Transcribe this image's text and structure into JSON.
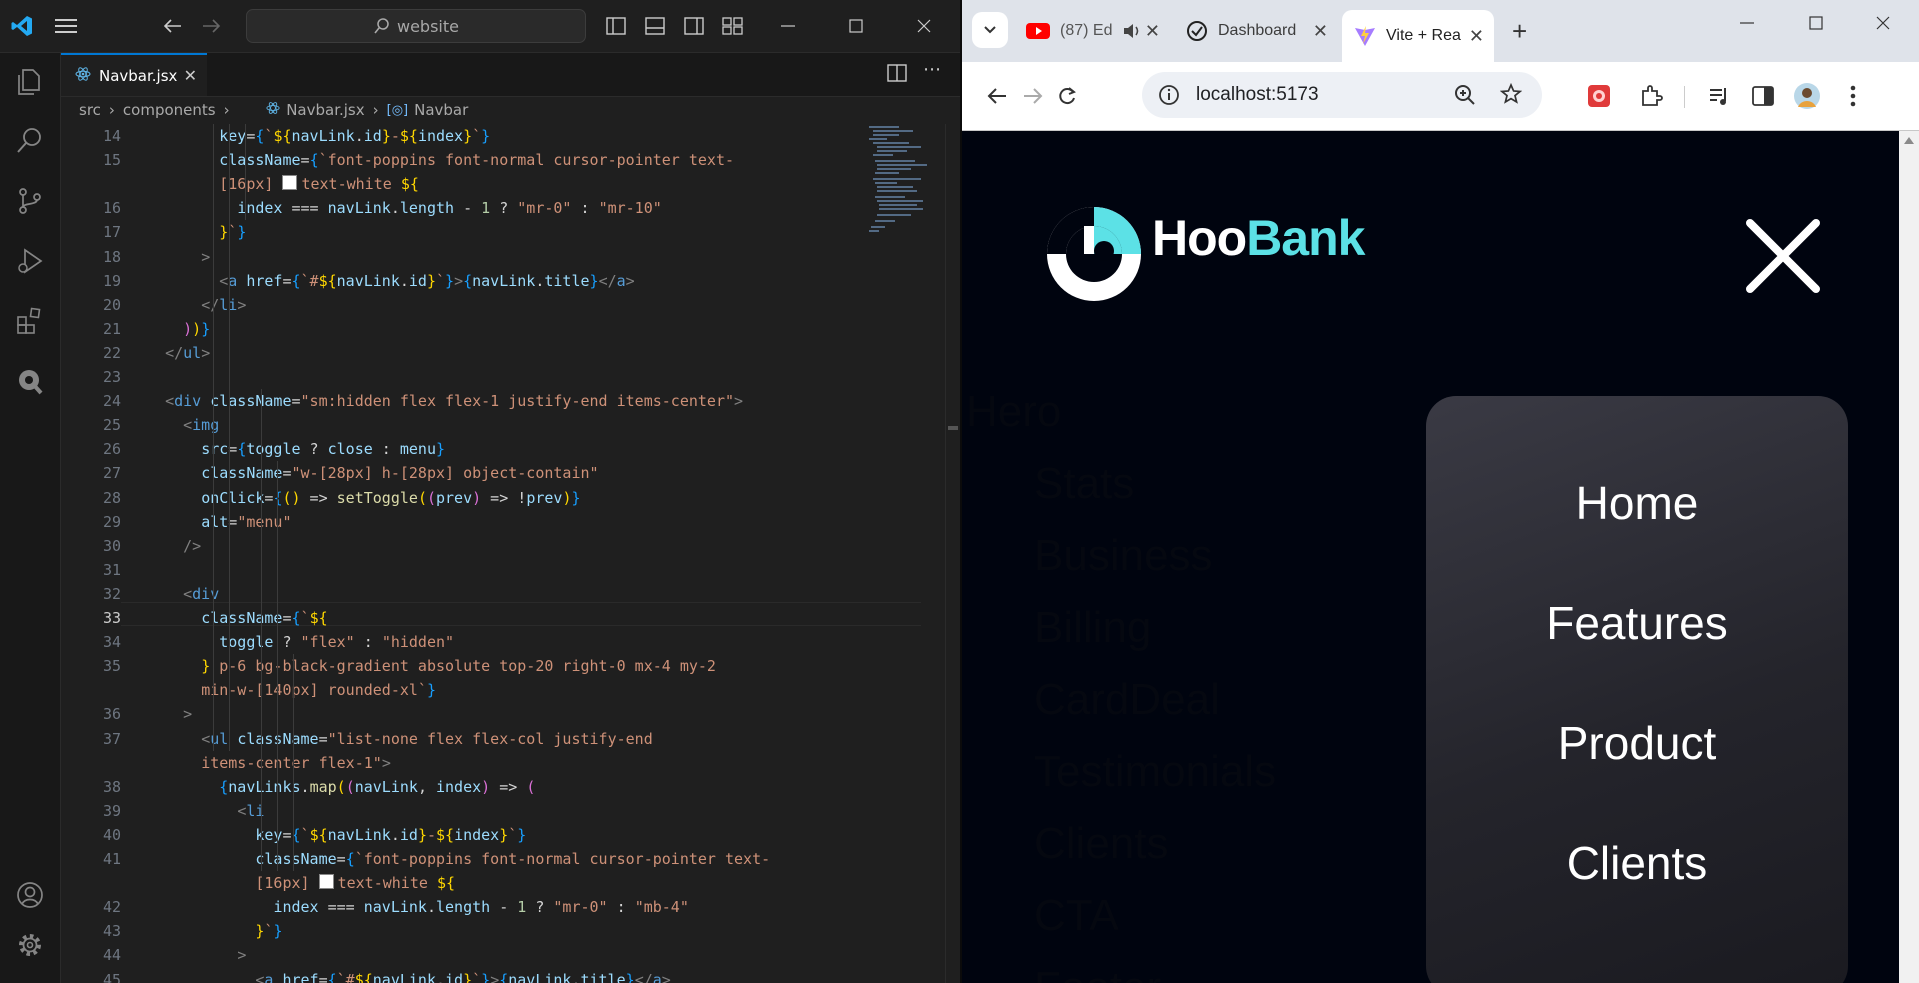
{
  "vscode": {
    "search_text": "website",
    "tab_label": "Navbar.jsx",
    "breadcrumbs": [
      "src",
      "components",
      "Navbar.jsx",
      "Navbar"
    ],
    "active_line": "33",
    "lines": [
      {
        "n": "14",
        "t": [
          [
            "",
            "        "
          ],
          [
            "at",
            "key"
          ],
          [
            "op",
            "="
          ],
          [
            "br3",
            "{"
          ],
          [
            "st",
            "`"
          ],
          [
            "br1",
            "${"
          ],
          [
            "vr",
            "navLink"
          ],
          [
            "op",
            "."
          ],
          [
            "vr",
            "id"
          ],
          [
            "br1",
            "}"
          ],
          [
            "st",
            "-"
          ],
          [
            "br1",
            "${"
          ],
          [
            "vr",
            "index"
          ],
          [
            "br1",
            "}"
          ],
          [
            "st",
            "`"
          ],
          [
            "br3",
            "}"
          ]
        ]
      },
      {
        "n": "15",
        "t": [
          [
            "",
            "        "
          ],
          [
            "at",
            "className"
          ],
          [
            "op",
            "="
          ],
          [
            "br3",
            "{"
          ],
          [
            "st",
            "`font-poppins font-normal cursor-pointer text-"
          ]
        ]
      },
      {
        "n": "",
        "t": [
          [
            "",
            "        "
          ],
          [
            "st",
            "[16px] "
          ],
          [
            "sq",
            ""
          ],
          [
            "st",
            "text-white "
          ],
          [
            "br1",
            "${"
          ]
        ]
      },
      {
        "n": "16",
        "t": [
          [
            "",
            "          "
          ],
          [
            "vr",
            "index"
          ],
          [
            "op",
            " === "
          ],
          [
            "vr",
            "navLink"
          ],
          [
            "op",
            "."
          ],
          [
            "vr",
            "length"
          ],
          [
            "op",
            " - "
          ],
          [
            "nm",
            "1"
          ],
          [
            "op",
            " ? "
          ],
          [
            "st",
            "\"mr-0\""
          ],
          [
            "op",
            " : "
          ],
          [
            "st",
            "\"mr-10\""
          ]
        ]
      },
      {
        "n": "17",
        "t": [
          [
            "",
            "        "
          ],
          [
            "br1",
            "}"
          ],
          [
            "st",
            "`"
          ],
          [
            "br3",
            "}"
          ]
        ]
      },
      {
        "n": "18",
        "t": [
          [
            "",
            "      "
          ],
          [
            "tg",
            ">"
          ]
        ]
      },
      {
        "n": "19",
        "t": [
          [
            "",
            "        "
          ],
          [
            "tg",
            "<"
          ],
          [
            "tn",
            "a"
          ],
          [
            "op",
            " "
          ],
          [
            "at",
            "href"
          ],
          [
            "op",
            "="
          ],
          [
            "br3",
            "{"
          ],
          [
            "st",
            "`#"
          ],
          [
            "br1",
            "${"
          ],
          [
            "vr",
            "navLink"
          ],
          [
            "op",
            "."
          ],
          [
            "vr",
            "id"
          ],
          [
            "br1",
            "}"
          ],
          [
            "st",
            "`"
          ],
          [
            "br3",
            "}"
          ],
          [
            "tg",
            ">"
          ],
          [
            "br3",
            "{"
          ],
          [
            "vr",
            "navLink"
          ],
          [
            "op",
            "."
          ],
          [
            "vr",
            "title"
          ],
          [
            "br3",
            "}"
          ],
          [
            "tg",
            "</"
          ],
          [
            "tn",
            "a"
          ],
          [
            "tg",
            ">"
          ]
        ]
      },
      {
        "n": "20",
        "t": [
          [
            "",
            "      "
          ],
          [
            "tg",
            "</"
          ],
          [
            "tn",
            "li"
          ],
          [
            "tg",
            ">"
          ]
        ]
      },
      {
        "n": "21",
        "t": [
          [
            "",
            "    "
          ],
          [
            "br2",
            ")"
          ],
          [
            "br1",
            ")"
          ],
          [
            "br3",
            "}"
          ]
        ]
      },
      {
        "n": "22",
        "t": [
          [
            "",
            "  "
          ],
          [
            "tg",
            "</"
          ],
          [
            "tn",
            "ul"
          ],
          [
            "tg",
            ">"
          ]
        ]
      },
      {
        "n": "23",
        "t": [
          [
            "",
            ""
          ]
        ]
      },
      {
        "n": "24",
        "t": [
          [
            "",
            "  "
          ],
          [
            "tg",
            "<"
          ],
          [
            "tn",
            "div"
          ],
          [
            "op",
            " "
          ],
          [
            "at",
            "className"
          ],
          [
            "op",
            "="
          ],
          [
            "st",
            "\"sm:hidden flex flex-1 justify-end items-center\""
          ],
          [
            "tg",
            ">"
          ]
        ]
      },
      {
        "n": "25",
        "t": [
          [
            "",
            "    "
          ],
          [
            "tg",
            "<"
          ],
          [
            "tn",
            "img"
          ]
        ]
      },
      {
        "n": "26",
        "t": [
          [
            "",
            "      "
          ],
          [
            "at",
            "src"
          ],
          [
            "op",
            "="
          ],
          [
            "br3",
            "{"
          ],
          [
            "vr",
            "toggle"
          ],
          [
            "op",
            " ? "
          ],
          [
            "vr",
            "close"
          ],
          [
            "op",
            " : "
          ],
          [
            "vr",
            "menu"
          ],
          [
            "br3",
            "}"
          ]
        ]
      },
      {
        "n": "27",
        "t": [
          [
            "",
            "      "
          ],
          [
            "at",
            "className"
          ],
          [
            "op",
            "="
          ],
          [
            "st",
            "\"w-[28px] h-[28px] object-contain\""
          ]
        ]
      },
      {
        "n": "28",
        "t": [
          [
            "",
            "      "
          ],
          [
            "at",
            "onClick"
          ],
          [
            "op",
            "="
          ],
          [
            "br3",
            "{"
          ],
          [
            "br1",
            "("
          ],
          [
            "br1",
            ")"
          ],
          [
            "op",
            " => "
          ],
          [
            "fn",
            "setToggle"
          ],
          [
            "br1",
            "("
          ],
          [
            "br2",
            "("
          ],
          [
            "vr",
            "prev"
          ],
          [
            "br2",
            ")"
          ],
          [
            "op",
            " => "
          ],
          [
            "op",
            "!"
          ],
          [
            "vr",
            "prev"
          ],
          [
            "br1",
            ")"
          ],
          [
            "br3",
            "}"
          ]
        ]
      },
      {
        "n": "29",
        "t": [
          [
            "",
            "      "
          ],
          [
            "at",
            "alt"
          ],
          [
            "op",
            "="
          ],
          [
            "st",
            "\"menu\""
          ]
        ]
      },
      {
        "n": "30",
        "t": [
          [
            "",
            "    "
          ],
          [
            "tg",
            "/>"
          ]
        ]
      },
      {
        "n": "31",
        "t": [
          [
            "",
            ""
          ]
        ]
      },
      {
        "n": "32",
        "t": [
          [
            "",
            "    "
          ],
          [
            "tg",
            "<"
          ],
          [
            "tn",
            "div"
          ]
        ]
      },
      {
        "n": "33",
        "t": [
          [
            "",
            "      "
          ],
          [
            "at",
            "className"
          ],
          [
            "op",
            "="
          ],
          [
            "br3",
            "{"
          ],
          [
            "st",
            "`"
          ],
          [
            "br1",
            "${"
          ]
        ]
      },
      {
        "n": "34",
        "t": [
          [
            "",
            "        "
          ],
          [
            "vr",
            "toggle"
          ],
          [
            "op",
            " ? "
          ],
          [
            "st",
            "\"flex\""
          ],
          [
            "op",
            " : "
          ],
          [
            "st",
            "\"hidden\""
          ]
        ]
      },
      {
        "n": "35",
        "t": [
          [
            "",
            "      "
          ],
          [
            "br1",
            "}"
          ],
          [
            "st",
            " p-6 bg-black-gradient absolute top-20 right-0 mx-4 my-2"
          ]
        ]
      },
      {
        "n": "",
        "t": [
          [
            "",
            "      "
          ],
          [
            "st",
            "min-w-[140px] rounded-xl`"
          ],
          [
            "br3",
            "}"
          ]
        ]
      },
      {
        "n": "36",
        "t": [
          [
            "",
            "    "
          ],
          [
            "tg",
            ">"
          ]
        ]
      },
      {
        "n": "37",
        "t": [
          [
            "",
            "      "
          ],
          [
            "tg",
            "<"
          ],
          [
            "tn",
            "ul"
          ],
          [
            "op",
            " "
          ],
          [
            "at",
            "className"
          ],
          [
            "op",
            "="
          ],
          [
            "st",
            "\"list-none flex flex-col justify-end"
          ]
        ]
      },
      {
        "n": "",
        "t": [
          [
            "",
            "      "
          ],
          [
            "st",
            "items-center flex-1\""
          ],
          [
            "tg",
            ">"
          ]
        ]
      },
      {
        "n": "38",
        "t": [
          [
            "",
            "        "
          ],
          [
            "br3",
            "{"
          ],
          [
            "vr",
            "navLinks"
          ],
          [
            "op",
            "."
          ],
          [
            "fn",
            "map"
          ],
          [
            "br1",
            "("
          ],
          [
            "br2",
            "("
          ],
          [
            "vr",
            "navLink"
          ],
          [
            "op",
            ", "
          ],
          [
            "vr",
            "index"
          ],
          [
            "br2",
            ")"
          ],
          [
            "op",
            " => "
          ],
          [
            "br2",
            "("
          ]
        ]
      },
      {
        "n": "39",
        "t": [
          [
            "",
            "          "
          ],
          [
            "tg",
            "<"
          ],
          [
            "tn",
            "li"
          ]
        ]
      },
      {
        "n": "40",
        "t": [
          [
            "",
            "            "
          ],
          [
            "at",
            "key"
          ],
          [
            "op",
            "="
          ],
          [
            "br3",
            "{"
          ],
          [
            "st",
            "`"
          ],
          [
            "br1",
            "${"
          ],
          [
            "vr",
            "navLink"
          ],
          [
            "op",
            "."
          ],
          [
            "vr",
            "id"
          ],
          [
            "br1",
            "}"
          ],
          [
            "st",
            "-"
          ],
          [
            "br1",
            "${"
          ],
          [
            "vr",
            "index"
          ],
          [
            "br1",
            "}"
          ],
          [
            "st",
            "`"
          ],
          [
            "br3",
            "}"
          ]
        ]
      },
      {
        "n": "41",
        "t": [
          [
            "",
            "            "
          ],
          [
            "at",
            "className"
          ],
          [
            "op",
            "="
          ],
          [
            "br3",
            "{"
          ],
          [
            "st",
            "`font-poppins font-normal cursor-pointer text-"
          ]
        ]
      },
      {
        "n": "",
        "t": [
          [
            "",
            "            "
          ],
          [
            "st",
            "[16px] "
          ],
          [
            "sq",
            ""
          ],
          [
            "st",
            "text-white "
          ],
          [
            "br1",
            "${"
          ]
        ]
      },
      {
        "n": "42",
        "t": [
          [
            "",
            "              "
          ],
          [
            "vr",
            "index"
          ],
          [
            "op",
            " === "
          ],
          [
            "vr",
            "navLink"
          ],
          [
            "op",
            "."
          ],
          [
            "vr",
            "length"
          ],
          [
            "op",
            " - "
          ],
          [
            "nm",
            "1"
          ],
          [
            "op",
            " ? "
          ],
          [
            "st",
            "\"mr-0\""
          ],
          [
            "op",
            " : "
          ],
          [
            "st",
            "\"mb-4\""
          ]
        ]
      },
      {
        "n": "43",
        "t": [
          [
            "",
            "            "
          ],
          [
            "br1",
            "}"
          ],
          [
            "st",
            "`"
          ],
          [
            "br3",
            "}"
          ]
        ]
      },
      {
        "n": "44",
        "t": [
          [
            "",
            "          "
          ],
          [
            "tg",
            ">"
          ]
        ]
      },
      {
        "n": "45",
        "t": [
          [
            "",
            "            "
          ],
          [
            "tg",
            "<"
          ],
          [
            "tn",
            "a"
          ],
          [
            "op",
            " "
          ],
          [
            "at",
            "href"
          ],
          [
            "op",
            "="
          ],
          [
            "br3",
            "{"
          ],
          [
            "st",
            "`#"
          ],
          [
            "br1",
            "${"
          ],
          [
            "vr",
            "navLink"
          ],
          [
            "op",
            "."
          ],
          [
            "vr",
            "id"
          ],
          [
            "br1",
            "}"
          ],
          [
            "st",
            "`"
          ],
          [
            "br3",
            "}"
          ],
          [
            "tg",
            ">"
          ],
          [
            "br3",
            "{"
          ],
          [
            "vr",
            "navLink"
          ],
          [
            "op",
            "."
          ],
          [
            "vr",
            "title"
          ],
          [
            "br3",
            "}"
          ],
          [
            "tg",
            "</"
          ],
          [
            "tn",
            "a"
          ],
          [
            "tg",
            ">"
          ]
        ]
      }
    ]
  },
  "browser": {
    "tabs": [
      {
        "label": "(87) Ed",
        "icon": "youtube-icon"
      },
      {
        "label": "Dashboard",
        "icon": "dashboard-icon"
      },
      {
        "label": "Vite + Rea",
        "icon": "vite-icon"
      }
    ],
    "url": "localhost:5173",
    "page": {
      "brand_left": "Hoo",
      "brand_right": "Bank",
      "background_sections": [
        "Hero",
        "Stats",
        "Business",
        "Billing",
        "CardDeal",
        "Testimonials",
        "Clients",
        "CTA",
        "Footer"
      ],
      "menu_items": [
        "Home",
        "Features",
        "Product",
        "Clients"
      ]
    }
  },
  "colors": {
    "accent": "#0078d4",
    "brand_cyan": "#5ce1e6",
    "page_bg": "#00040f"
  }
}
